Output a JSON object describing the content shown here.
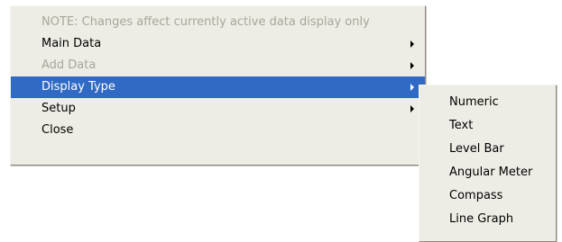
{
  "main_menu": {
    "items": [
      {
        "label": "NOTE: Changes affect currently active data display only",
        "state": "disabled"
      },
      {
        "label": "Main Data",
        "submenu": true
      },
      {
        "label": "Add Data",
        "state": "disabled",
        "submenu": true
      },
      {
        "label": "Display Type",
        "state": "selected",
        "submenu": true
      },
      {
        "label": "Setup",
        "submenu": true
      },
      {
        "label": "Close"
      }
    ]
  },
  "display_type_submenu": {
    "items": [
      {
        "label": "Numeric"
      },
      {
        "label": "Text"
      },
      {
        "label": "Level Bar"
      },
      {
        "label": "Angular Meter"
      },
      {
        "label": "Compass"
      },
      {
        "label": "Line Graph"
      }
    ]
  },
  "icons": {
    "submenu_arrow": "chevron-right-icon"
  },
  "colors": {
    "menu_background": "#eeede5",
    "selection": "#316ac5",
    "disabled_text": "#a7a69c"
  }
}
